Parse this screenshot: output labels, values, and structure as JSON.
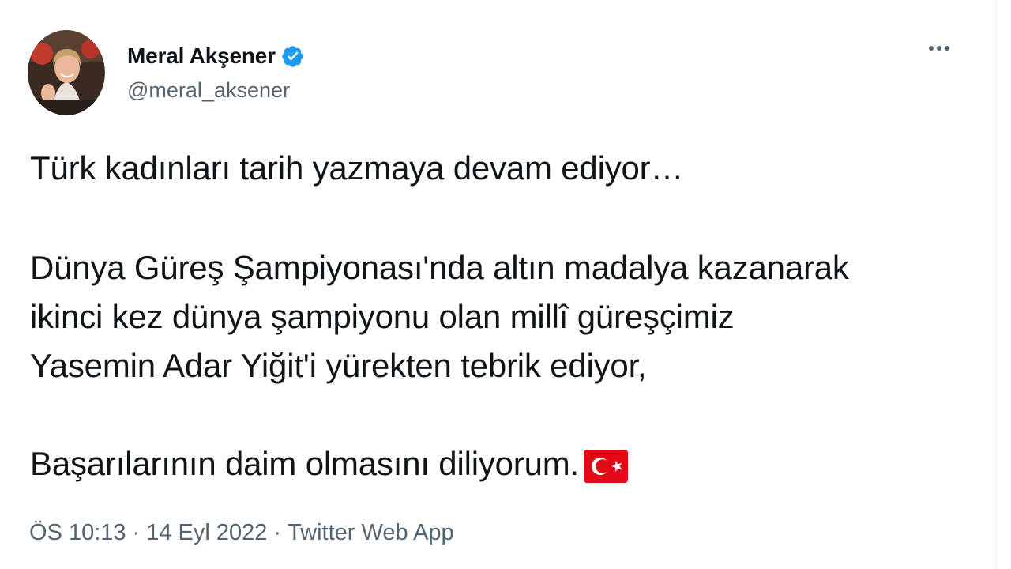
{
  "author": {
    "display_name": "Meral Akşener",
    "handle": "@meral_aksener",
    "verified_icon": "verified-badge-icon",
    "avatar_icon": "avatar"
  },
  "menu": {
    "icon": "more-dots-icon"
  },
  "tweet": {
    "line1": "Türk kadınları tarih yazmaya devam ediyor…",
    "para2_line1": "Dünya Güreş Şampiyonası'nda altın madalya kazanarak",
    "para2_line2": "ikinci kez dünya şampiyonu olan millî güreşçimiz",
    "para2_line3": "Yasemin Adar Yiğit'i yürekten tebrik ediyor,",
    "line_last": "Başarılarının daim olmasını diliyorum.",
    "emoji": "turkey-flag-icon"
  },
  "meta": {
    "time": "ÖS 10:13",
    "separator": "·",
    "date": "14 Eyl 2022",
    "source": "Twitter Web App"
  },
  "colors": {
    "text": "#0f1419",
    "secondary": "#536471",
    "verified": "#1d9bf0",
    "flag_red": "#e30a17"
  }
}
